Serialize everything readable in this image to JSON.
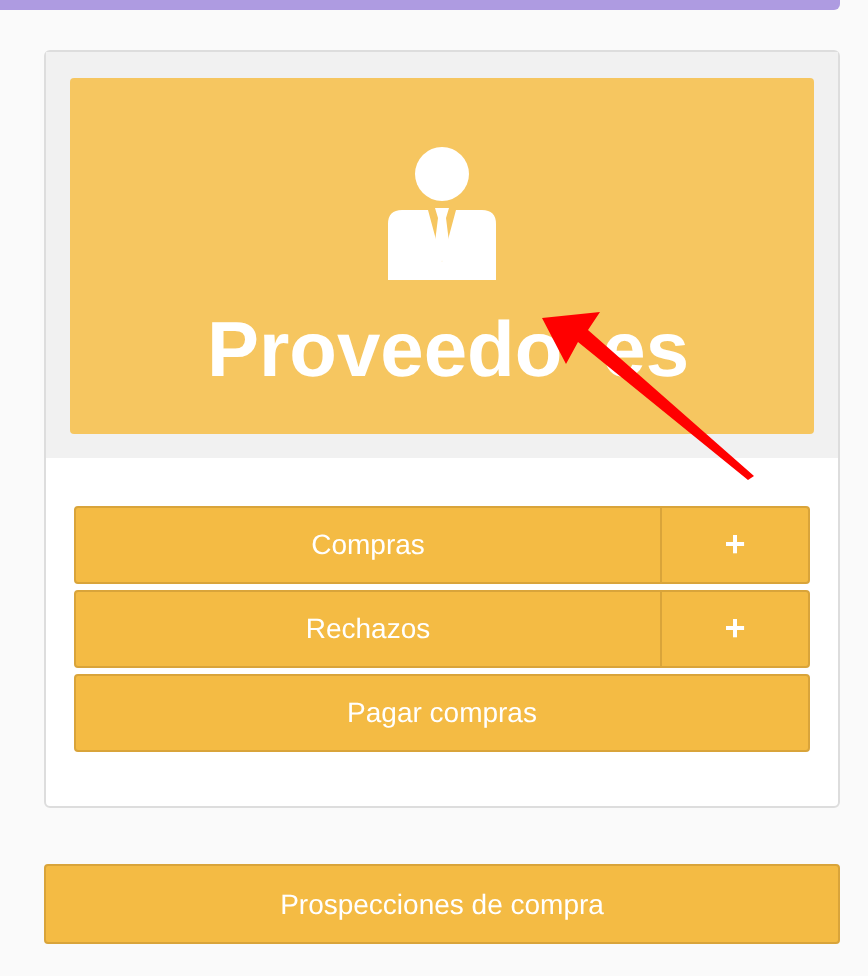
{
  "tile": {
    "title_parts": [
      "Proveedo",
      "es"
    ]
  },
  "actions": [
    {
      "kind": "split",
      "label": "Compras",
      "side_label": "+"
    },
    {
      "kind": "split",
      "label": "Rechazos",
      "side_label": "+"
    },
    {
      "kind": "plain",
      "label": "Pagar compras"
    }
  ],
  "footer_button": {
    "label": "Prospecciones de compra"
  }
}
